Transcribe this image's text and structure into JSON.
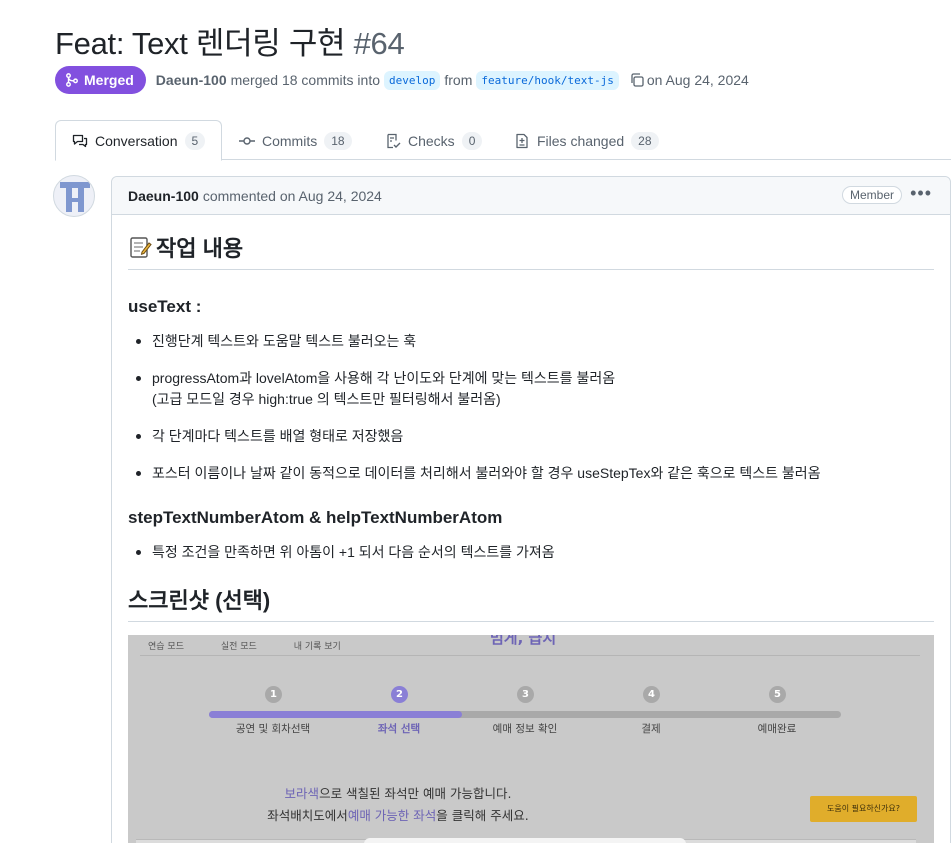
{
  "pr": {
    "title": "Feat: Text 렌더링 구현",
    "number": "#64",
    "state": "Merged",
    "author": "Daeun-100",
    "merged_text": "merged 18 commits into",
    "base_branch": "develop",
    "from_text": "from",
    "head_branch": "feature/hook/text-js",
    "date_text": "on Aug 24, 2024"
  },
  "tabs": [
    {
      "label": "Conversation",
      "count": "5"
    },
    {
      "label": "Commits",
      "count": "18"
    },
    {
      "label": "Checks",
      "count": "0"
    },
    {
      "label": "Files changed",
      "count": "28"
    }
  ],
  "comment": {
    "author": "Daeun-100",
    "meta": "commented on Aug 24, 2024",
    "badge": "Member",
    "heading": "작업 내용",
    "section1_title": "useText :",
    "section1_items": [
      "진행단계 텍스트와 도움말 텍스트 불러오는 훅",
      "progressAtom과 lovelAtom을 사용해 각 난이도와 단계에 맞는 텍스트를 불러옴",
      "(고급 모드일 경우 high:true 의 텍스트만 필터링해서 불러옴)",
      "각 단계마다 텍스트를 배열 형태로 저장했음",
      "포스터 이름이나 날짜 같이 동적으로 데이터를 처리해서 불러와야 할 경우 useStepTex와 같은 훅으로 텍스트 불러옴"
    ],
    "section2_title": "stepTextNumberAtom & helpTextNumberAtom",
    "section2_items": [
      "특정 조건을 만족하면 위 아톰이 +1 되서 다음 순서의 텍스트를 가져옴"
    ],
    "screenshot_heading": "스크린샷 (선택)"
  },
  "screenshot": {
    "top_title": "멈게, 급지",
    "modes": [
      "연습 모드",
      "실전 모드",
      "내 기록 보기"
    ],
    "steps": [
      {
        "num": "1",
        "label": "공연 및 회차선택"
      },
      {
        "num": "2",
        "label": "좌석 선택"
      },
      {
        "num": "3",
        "label": "예매 정보 확인"
      },
      {
        "num": "4",
        "label": "결제"
      },
      {
        "num": "5",
        "label": "예매완료"
      }
    ],
    "progress": 0.4,
    "line1_a": "보라색",
    "line1_b": "으로 색칠된 좌석만 예매 가능합니다.",
    "line2_a": "좌석배치도에서",
    "line2_b": "예매 가능한 좌석",
    "line2_c": "을 클릭해 주세요.",
    "help_button": "도움이 필요하신가요?",
    "colors": {
      "accent": "#8a7fd6",
      "track": "#a9a9a9",
      "help": "#e0ad2b"
    }
  },
  "colors": {
    "merged": "#8250df",
    "link": "#0969da"
  }
}
